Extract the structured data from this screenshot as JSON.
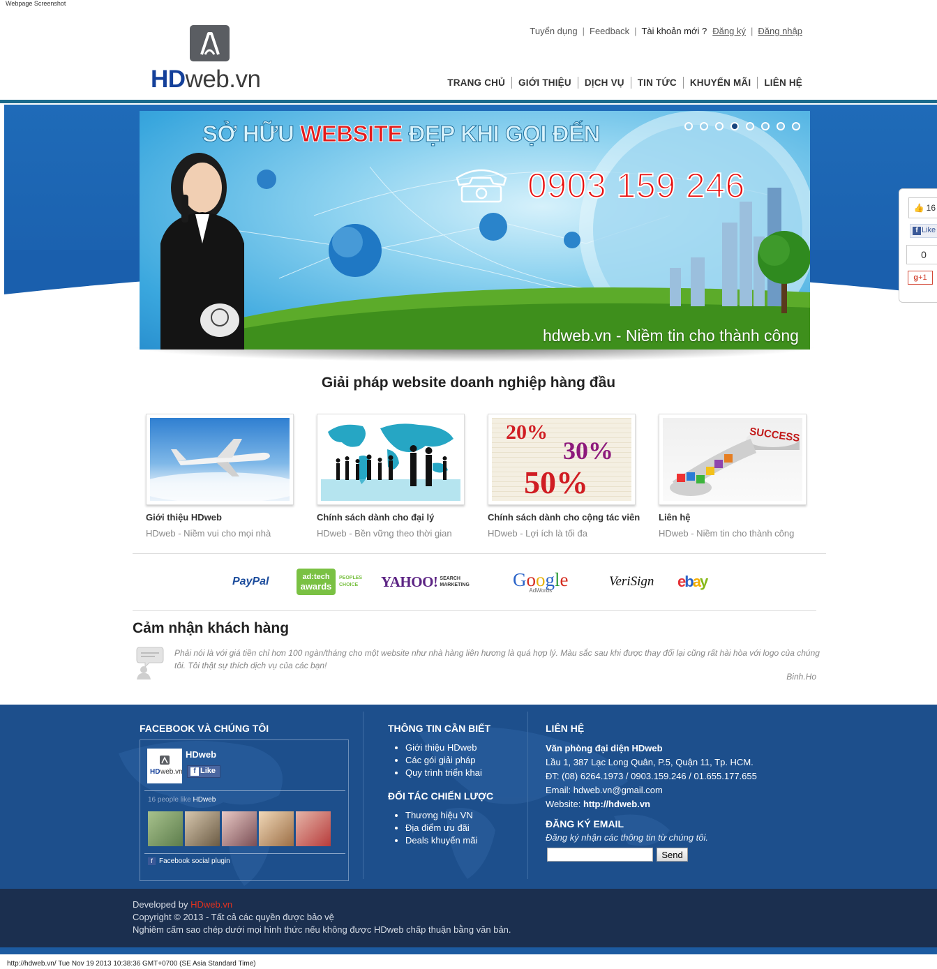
{
  "screenshot_label": "Webpage Screenshot",
  "logo": {
    "brand_bold": "HD",
    "brand_rest": "web.vn"
  },
  "top_links": {
    "careers": "Tuyển dụng",
    "feedback": "Feedback",
    "new_account": "Tài khoản mới ?",
    "register": "Đăng ký",
    "login": "Đăng nhập"
  },
  "nav": [
    "TRANG CHỦ",
    "GIỚI THIỆU",
    "DỊCH VỤ",
    "TIN TỨC",
    "KHUYẾN MÃI",
    "LIÊN HỆ"
  ],
  "slider": {
    "headline_a": "SỞ HỮU ",
    "headline_b": "WEBSITE",
    "headline_c": " ĐẸP KHI GỌI ĐẾN",
    "phone": "0903 159 246",
    "tagline": "hdweb.vn - Niềm tin cho thành công",
    "dots_total": 8,
    "active_dot": 3
  },
  "social": {
    "fb_count": "16",
    "fb_like": "Like",
    "gplus_count": "0",
    "gplus_label": "+1"
  },
  "solutions": {
    "title": "Giải pháp website doanh nghiệp hàng đầu",
    "cards": [
      {
        "title": "Giới thiệu HDweb",
        "sub": "HDweb - Niềm vui cho mọi nhà"
      },
      {
        "title": "Chính sách dành cho đại lý",
        "sub": "HDweb - Bền vững theo thời gian"
      },
      {
        "title": "Chính sách dành cho cộng tác viên",
        "sub": "HDweb - Lợi ích là tối đa"
      },
      {
        "title": "Liên hệ",
        "sub": "HDweb - Niềm tin cho thành công"
      }
    ],
    "card_image_text": {
      "discount1": "20%",
      "discount2": "30%",
      "discount3": "50%",
      "success": "SUCCESS"
    }
  },
  "partners": {
    "paypal": "PayPal",
    "adtech_top": "ad:tech",
    "adtech_bottom": "awards",
    "adtech_note1": "PEOPLES",
    "adtech_note2": "CHOICE",
    "yahoo": "YAHOO!",
    "yahoo_note1": "SEARCH",
    "yahoo_note2": "MARKETING",
    "google": "Google",
    "google_note": "AdWords",
    "verisign": "VeriSign",
    "ebay": "ebay"
  },
  "testimonials": {
    "title": "Cảm nhận khách hàng",
    "quote": "Phải nói là với giá tiền chỉ hơn 100 ngàn/tháng cho một website như nhà hàng liên hương là quá hợp lý. Màu sắc sau khi được thay đổi lại cũng rất hài hòa với logo của chúng tôi. Tôi thật sự thích dịch vụ của các bạn!",
    "author": "Binh.Ho"
  },
  "footer": {
    "facebook": {
      "title": "FACEBOOK VÀ CHÚNG TÔI",
      "page_name": "HDweb",
      "like": "Like",
      "likes_text": "16 people like",
      "likes_page": "HDweb",
      "plugin": "Facebook social plugin"
    },
    "info": {
      "title": "THÔNG TIN CẦN BIẾT",
      "items": [
        "Giới thiệu HDweb",
        "Các gói giải pháp",
        "Quy trình triển khai"
      ],
      "partners_title": "ĐỐI TÁC CHIẾN LƯỢC",
      "partner_items": [
        "Thương hiệu VN",
        "Địa điểm ưu đãi",
        "Deals khuyến mãi"
      ]
    },
    "contact": {
      "title": "LIÊN HỆ",
      "office": "Văn phòng đại diện HDweb",
      "address": "Lầu 1, 387 Lạc Long Quân, P.5, Quận 11, Tp. HCM.",
      "phone": "ĐT: (08) 6264.1973 / 0903.159.246 / 01.655.177.655",
      "email": "Email: hdweb.vn@gmail.com",
      "website_label": "Website: ",
      "website": "http://hdweb.vn",
      "newsletter_title": "ĐĂNG KÝ EMAIL",
      "newsletter_hint": "Đăng ký nhận các thông tin từ chúng tôi.",
      "email_value": "",
      "send": "Send"
    }
  },
  "bottom": {
    "developed_by": "Developed by ",
    "developer": "HDweb.vn",
    "copyright": "Copyright © 2013 - Tất cả các quyền được bảo vệ",
    "notice": "Nghiêm cấm sao chép dưới mọi hình thức nếu không được HDweb chấp thuận bằng văn bản."
  },
  "status_bar": "http://hdweb.vn/ Tue Nov 19 2013 10:38:36 GMT+0700 (SE Asia Standard Time)"
}
